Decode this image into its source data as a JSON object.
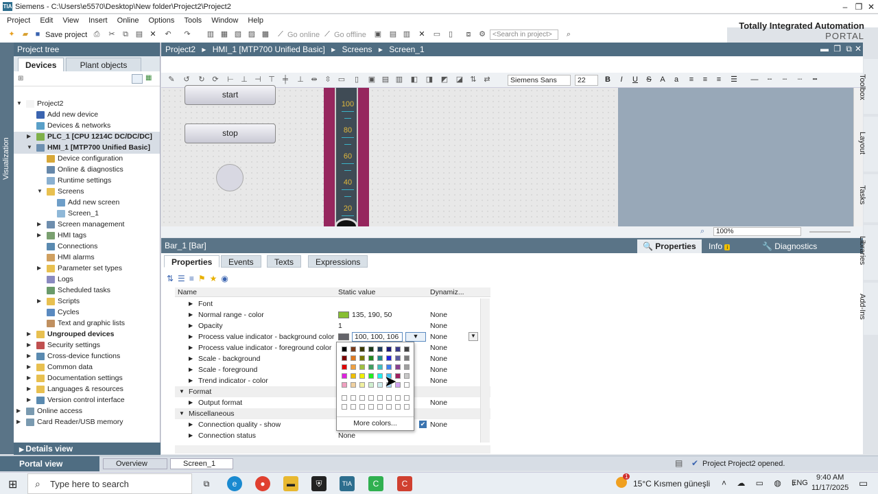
{
  "window": {
    "title": "Siemens  -  C:\\Users\\e5570\\Desktop\\New folder\\Project2\\Project2",
    "logo": "TIA"
  },
  "menu": [
    "Project",
    "Edit",
    "View",
    "Insert",
    "Online",
    "Options",
    "Tools",
    "Window",
    "Help"
  ],
  "brand": {
    "line1": "Totally Integrated Automation",
    "line2": "PORTAL"
  },
  "toolbar": {
    "save": "Save project",
    "go_online": "Go online",
    "go_offline": "Go offline",
    "search_placeholder": "<Search in project>"
  },
  "left": {
    "vertical_tab": "Visualization",
    "header": "Project tree",
    "tabs": [
      "Devices",
      "Plant objects"
    ],
    "details": "Details view",
    "tree": [
      {
        "label": "Project2",
        "indent": 0,
        "arrow": "▼",
        "icon": "#f4f4f4"
      },
      {
        "label": "Add new device",
        "indent": 1,
        "arrow": "",
        "icon": "#3a64b0"
      },
      {
        "label": "Devices & networks",
        "indent": 1,
        "arrow": "",
        "icon": "#5aa0c8"
      },
      {
        "label": "PLC_1 [CPU 1214C DC/DC/DC]",
        "indent": 1,
        "arrow": "▶",
        "icon": "#7fb04a",
        "bold": true,
        "sel": true
      },
      {
        "label": "HMI_1 [MTP700 Unified Basic]",
        "indent": 1,
        "arrow": "▼",
        "icon": "#6d8fb0",
        "bold": true,
        "sel": true
      },
      {
        "label": "Device configuration",
        "indent": 2,
        "arrow": "",
        "icon": "#d8a838"
      },
      {
        "label": "Online & diagnostics",
        "indent": 2,
        "arrow": "",
        "icon": "#6688aa"
      },
      {
        "label": "Runtime settings",
        "indent": 2,
        "arrow": "",
        "icon": "#8ab0d0"
      },
      {
        "label": "Screens",
        "indent": 2,
        "arrow": "▼",
        "icon": "#e8c050"
      },
      {
        "label": "Add new screen",
        "indent": 3,
        "arrow": "",
        "icon": "#6e9ec8"
      },
      {
        "label": "Screen_1",
        "indent": 3,
        "arrow": "",
        "icon": "#8fb8d8"
      },
      {
        "label": "Screen management",
        "indent": 2,
        "arrow": "▶",
        "icon": "#6e8eae"
      },
      {
        "label": "HMI tags",
        "indent": 2,
        "arrow": "▶",
        "icon": "#7aa070"
      },
      {
        "label": "Connections",
        "indent": 2,
        "arrow": "",
        "icon": "#5a8ab0"
      },
      {
        "label": "HMI alarms",
        "indent": 2,
        "arrow": "",
        "icon": "#d0a060"
      },
      {
        "label": "Parameter set types",
        "indent": 2,
        "arrow": "▶",
        "icon": "#e8c050"
      },
      {
        "label": "Logs",
        "indent": 2,
        "arrow": "",
        "icon": "#8a8ac0"
      },
      {
        "label": "Scheduled tasks",
        "indent": 2,
        "arrow": "",
        "icon": "#6a9a6a"
      },
      {
        "label": "Scripts",
        "indent": 2,
        "arrow": "▶",
        "icon": "#e8c050"
      },
      {
        "label": "Cycles",
        "indent": 2,
        "arrow": "",
        "icon": "#5a8ac0"
      },
      {
        "label": "Text and graphic lists",
        "indent": 2,
        "arrow": "",
        "icon": "#c09060"
      },
      {
        "label": "Ungrouped devices",
        "indent": 1,
        "arrow": "▶",
        "icon": "#e8c050",
        "bold": true
      },
      {
        "label": "Security settings",
        "indent": 1,
        "arrow": "▶",
        "icon": "#c05050"
      },
      {
        "label": "Cross-device functions",
        "indent": 1,
        "arrow": "▶",
        "icon": "#5a8ab0"
      },
      {
        "label": "Common data",
        "indent": 1,
        "arrow": "▶",
        "icon": "#e8c050"
      },
      {
        "label": "Documentation settings",
        "indent": 1,
        "arrow": "▶",
        "icon": "#e8c050"
      },
      {
        "label": "Languages & resources",
        "indent": 1,
        "arrow": "▶",
        "icon": "#e8c050"
      },
      {
        "label": "Version control interface",
        "indent": 1,
        "arrow": "▶",
        "icon": "#5a8ab0"
      },
      {
        "label": "Online access",
        "indent": 0,
        "arrow": "▶",
        "icon": "#7a9ab0"
      },
      {
        "label": "Card Reader/USB memory",
        "indent": 0,
        "arrow": "▶",
        "icon": "#7a9ab0"
      }
    ]
  },
  "breadcrumb": [
    "Project2",
    "HMI_1 [MTP700 Unified Basic]",
    "Screens",
    "Screen_1"
  ],
  "editor": {
    "font": "Siemens Sans",
    "size": "22",
    "zoom": "100%",
    "buttons": [
      "start",
      "stop"
    ],
    "bar_scale": [
      "100",
      "80",
      "60",
      "40",
      "20"
    ]
  },
  "inspector": {
    "object": "Bar_1 [Bar]",
    "tabs": [
      "Properties",
      "Info",
      "Diagnostics"
    ],
    "info_badge": "i",
    "subtabs": [
      "Properties",
      "Events",
      "Texts",
      "Expressions"
    ],
    "columns": {
      "name": "Name",
      "static": "Static value",
      "dyn": "Dynamiz..."
    },
    "rows": [
      {
        "name": "Font",
        "level": 1
      },
      {
        "name": "Normal range - color",
        "level": 1,
        "value": "135, 190, 50",
        "swatch": "#87be32",
        "dyn": "None"
      },
      {
        "name": "Opacity",
        "level": 1,
        "value": "1",
        "dyn": "None"
      },
      {
        "name": "Process value indicator - background color",
        "level": 1,
        "value": "100, 100, 106",
        "swatch": "#64646a",
        "dyn": "None",
        "edit": true
      },
      {
        "name": "Process value indicator - foreground color",
        "level": 1,
        "dyn": "None"
      },
      {
        "name": "Scale - background",
        "level": 1,
        "dyn": "None"
      },
      {
        "name": "Scale - foreground",
        "level": 1,
        "dyn": "None"
      },
      {
        "name": "Trend indicator - color",
        "level": 1,
        "dyn": "None"
      },
      {
        "name": "Format",
        "level": 0,
        "sec": true
      },
      {
        "name": "Output format",
        "level": 1,
        "dyn": "None"
      },
      {
        "name": "Miscellaneous",
        "level": 0,
        "sec": true
      },
      {
        "name": "Connection quality - show",
        "level": 1,
        "dyn": "None",
        "check": true
      },
      {
        "name": "Connection status",
        "level": 1,
        "value": "None"
      }
    ],
    "more_colors": "More colors...",
    "palette": [
      [
        "#000000",
        "#7a3a1a",
        "#3a3a00",
        "#1a3a1a",
        "#1a3a5a",
        "#1a1a7a",
        "#3a3a8a",
        "#404040"
      ],
      [
        "#7a0000",
        "#e07a20",
        "#7a7a00",
        "#208a20",
        "#208a8a",
        "#2020e0",
        "#5a5aa0",
        "#7a7a7a"
      ],
      [
        "#e00000",
        "#f0a040",
        "#a0c040",
        "#40a060",
        "#40c0c0",
        "#4080f0",
        "#8a4090",
        "#a0a0a0"
      ],
      [
        "#e020e0",
        "#f0c000",
        "#f0f000",
        "#20f020",
        "#20f0f0",
        "#40c0f0",
        "#a02060",
        "#c8c8c8"
      ],
      [
        "#f0a0c0",
        "#f0d0a0",
        "#f0f0a0",
        "#d0f0d0",
        "#d0f0f0",
        "#a0d0f0",
        "#d0a0f0",
        "#ffffff"
      ],
      [
        "#ffffff",
        "#ffffff",
        "#ffffff",
        "#ffffff",
        "#ffffff",
        "#ffffff",
        "#ffffff",
        "#ffffff"
      ],
      [
        "#ffffff",
        "#ffffff",
        "#ffffff",
        "#ffffff",
        "#ffffff",
        "#ffffff",
        "#ffffff",
        "#ffffff"
      ]
    ]
  },
  "right_tabs": [
    "Toolbox",
    "Layout",
    "Tasks",
    "Libraries",
    "Add-Ins"
  ],
  "status": {
    "portal": "Portal view",
    "tabs": [
      "Overview",
      "Screen_1"
    ],
    "message": "Project Project2 opened."
  },
  "taskbar": {
    "search": "Type here to search",
    "weather": "15°C  Kısmen güneşli",
    "lang": "ENG",
    "time": "9:40 AM",
    "date": "11/17/2025",
    "badge": "1"
  }
}
